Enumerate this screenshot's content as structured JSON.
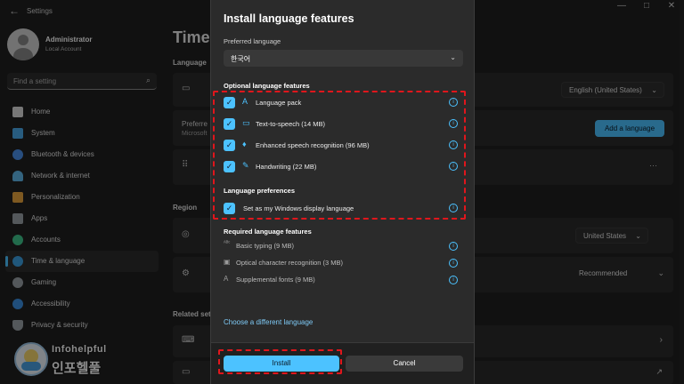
{
  "window": {
    "title": "Settings"
  },
  "profile": {
    "name": "Administrator",
    "role": "Local Account"
  },
  "search": {
    "placeholder": "Find a setting"
  },
  "nav": [
    {
      "label": "Home",
      "color": "#d9d9d9"
    },
    {
      "label": "System",
      "color": "#4aa8e8"
    },
    {
      "label": "Bluetooth & devices",
      "color": "#4a8fe8"
    },
    {
      "label": "Network & internet",
      "color": "#5fb6e8"
    },
    {
      "label": "Personalization",
      "color": "#e6a23c"
    },
    {
      "label": "Apps",
      "color": "#9aa0a6"
    },
    {
      "label": "Accounts",
      "color": "#3ec48a"
    },
    {
      "label": "Time & language",
      "color": "#3b9fe0"
    },
    {
      "label": "Gaming",
      "color": "#9aa0a6"
    },
    {
      "label": "Accessibility",
      "color": "#3b8fe0"
    },
    {
      "label": "Privacy & security",
      "color": "#9aa0a6"
    }
  ],
  "page": {
    "title": "Time",
    "section_language": "Language",
    "section_region": "Region",
    "section_related": "Related set",
    "display_language_value": "English (United States)",
    "add_language": "Add a language",
    "preferred_label": "Preferre",
    "preferred_sub": "Microsoft",
    "country_value": "United States",
    "format_value": "Recommended",
    "more": "···"
  },
  "dialog": {
    "title": "Install language features",
    "preferred_label": "Preferred language",
    "preferred_value": "한국어",
    "optional_heading": "Optional language features",
    "optional": [
      {
        "label": "Language pack",
        "icon": "A"
      },
      {
        "label": "Text-to-speech (14 MB)",
        "icon": "▭"
      },
      {
        "label": "Enhanced speech recognition (96 MB)",
        "icon": "♦"
      },
      {
        "label": "Handwriting (22 MB)",
        "icon": "✎"
      }
    ],
    "prefs_heading": "Language preferences",
    "pref_option": "Set as my Windows display language",
    "required_heading": "Required language features",
    "required": [
      {
        "label": "Basic typing (9 MB)",
        "icon": "ᴬᴮᶜ"
      },
      {
        "label": "Optical character recognition (3 MB)",
        "icon": "▣"
      },
      {
        "label": "Supplemental fonts (9 MB)",
        "icon": "A"
      }
    ],
    "link": "Choose a different language",
    "install": "Install",
    "cancel": "Cancel"
  },
  "watermark": {
    "line1": "Infohelpful",
    "line2": "인포헬풀"
  },
  "colors": {
    "accent": "#4cc2ff",
    "highlight": "#e0161c"
  }
}
